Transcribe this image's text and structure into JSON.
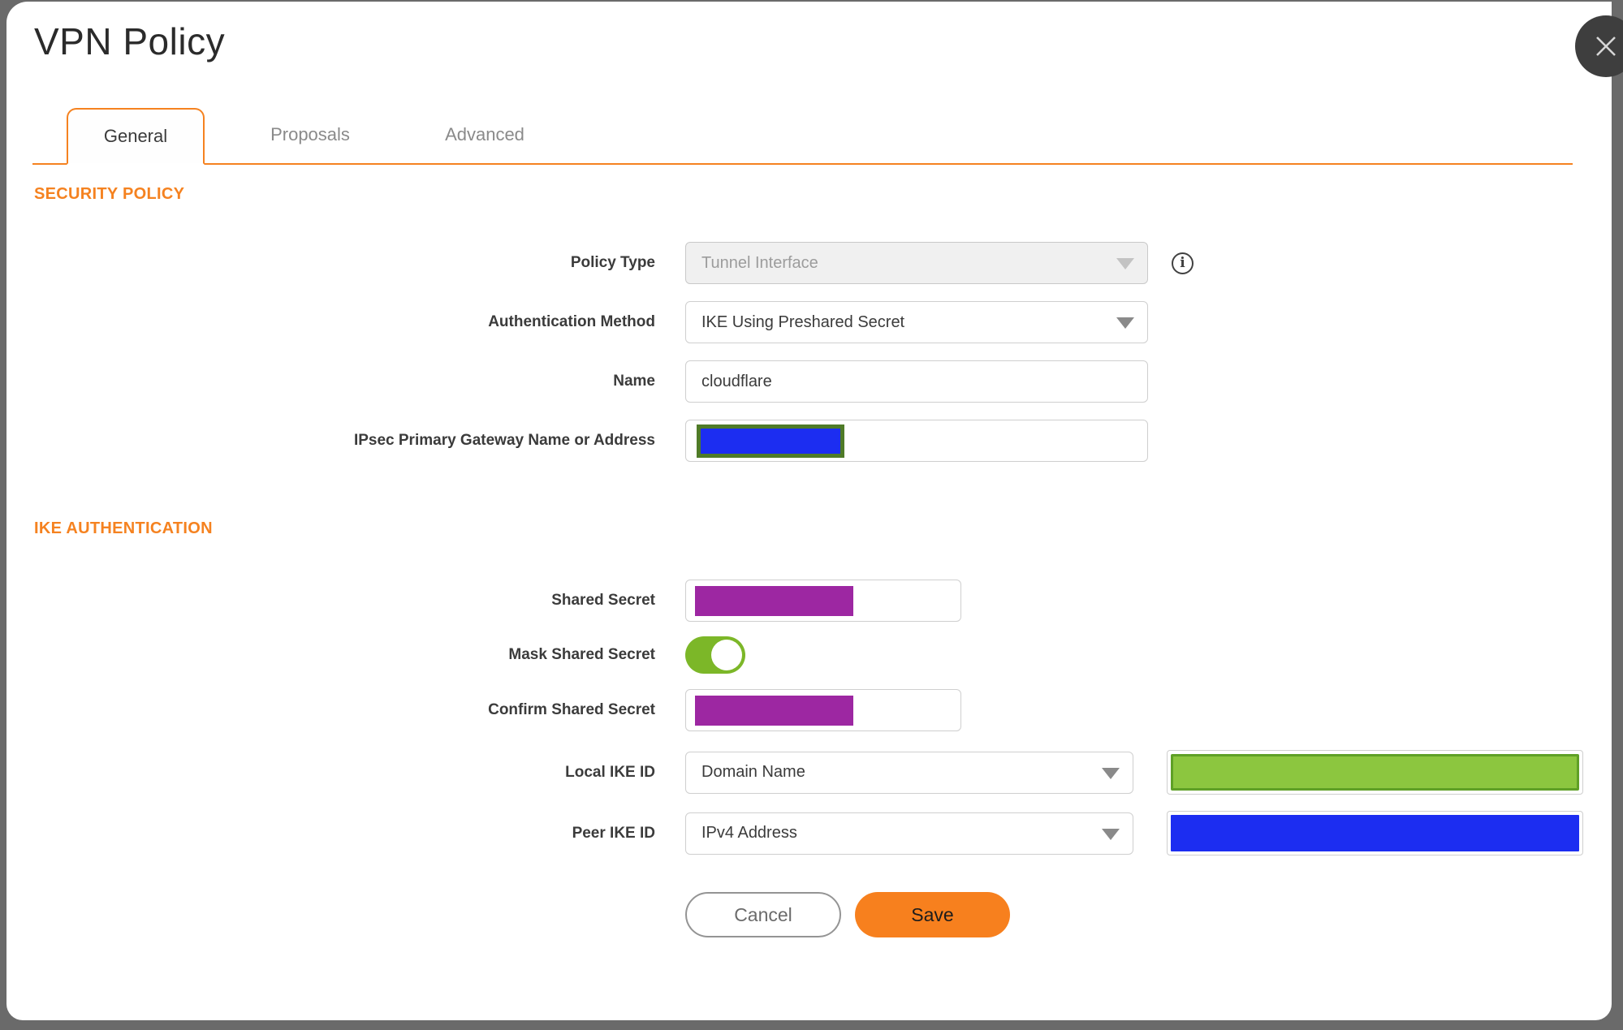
{
  "dialog": {
    "title": "VPN Policy",
    "close_icon": "x-icon"
  },
  "tabs": [
    {
      "label": "General",
      "active": true
    },
    {
      "label": "Proposals",
      "active": false
    },
    {
      "label": "Advanced",
      "active": false
    }
  ],
  "security_policy": {
    "heading": "SECURITY POLICY",
    "policy_type": {
      "label": "Policy Type",
      "value": "Tunnel Interface",
      "disabled": true,
      "info_icon": "info-icon"
    },
    "authentication_method": {
      "label": "Authentication Method",
      "value": "IKE Using Preshared Secret"
    },
    "name": {
      "label": "Name",
      "value": "cloudflare"
    },
    "ipsec_primary_gateway": {
      "label": "IPsec Primary Gateway Name or Address",
      "value": "",
      "redaction": "blue-box-green-border"
    }
  },
  "ike_authentication": {
    "heading": "IKE AUTHENTICATION",
    "shared_secret": {
      "label": "Shared Secret",
      "value": "",
      "redaction": "purple-box"
    },
    "mask_shared_secret": {
      "label": "Mask Shared Secret",
      "state": "on"
    },
    "confirm_shared_secret": {
      "label": "Confirm Shared Secret",
      "value": "",
      "redaction": "purple-box"
    },
    "local_ike_id": {
      "label": "Local IKE ID",
      "value": "Domain Name",
      "side_redaction": "green-box"
    },
    "peer_ike_id": {
      "label": "Peer IKE ID",
      "value": "IPv4 Address",
      "side_redaction": "blue-box"
    }
  },
  "buttons": {
    "cancel": "Cancel",
    "save": "Save"
  },
  "colors": {
    "accent_orange": "#F58220",
    "save_orange": "#F7801E",
    "toggle_green": "#7CB728",
    "redaction_purple": "#9D27A2",
    "redaction_blue": "#1C2DF1",
    "redaction_green_fill": "#8CC63F",
    "redaction_green_border": "#5FA026",
    "gateway_border_olive": "#4F7B28",
    "backdrop_gray": "#6A6A6A"
  }
}
